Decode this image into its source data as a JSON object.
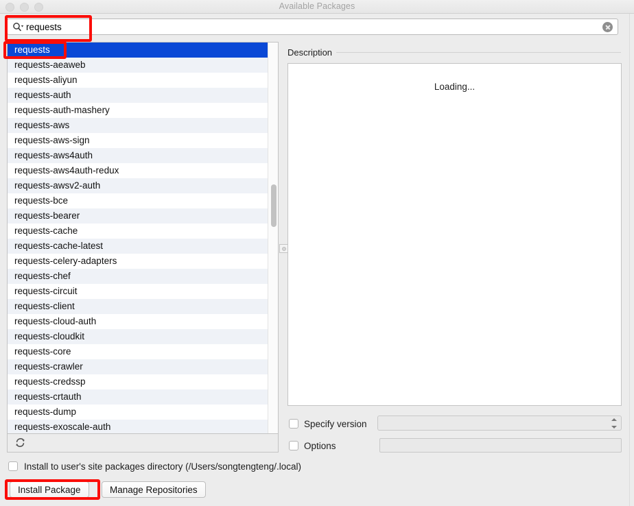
{
  "window": {
    "title": "Available Packages",
    "traffic_lights": [
      "close-button",
      "minimize-button",
      "zoom-button"
    ]
  },
  "search": {
    "icon": "search-icon",
    "value": "requests",
    "clear_icon": "clear-icon"
  },
  "package_list": {
    "selected": "requests",
    "items": [
      "requests",
      "requests-aeaweb",
      "requests-aliyun",
      "requests-auth",
      "requests-auth-mashery",
      "requests-aws",
      "requests-aws-sign",
      "requests-aws4auth",
      "requests-aws4auth-redux",
      "requests-awsv2-auth",
      "requests-bce",
      "requests-bearer",
      "requests-cache",
      "requests-cache-latest",
      "requests-celery-adapters",
      "requests-chef",
      "requests-circuit",
      "requests-client",
      "requests-cloud-auth",
      "requests-cloudkit",
      "requests-core",
      "requests-crawler",
      "requests-credssp",
      "requests-crtauth",
      "requests-dump",
      "requests-exoscale-auth"
    ],
    "refresh_icon": "refresh-icon"
  },
  "description": {
    "label": "Description",
    "body": "Loading..."
  },
  "options": {
    "specify_version_label": "Specify version",
    "specify_version_checked": false,
    "version_value": "",
    "options_label": "Options",
    "options_checked": false,
    "options_value": ""
  },
  "footer": {
    "user_site_label": "Install to user's site packages directory (/Users/songtengteng/.local)",
    "user_site_checked": false,
    "install_button": "Install Package",
    "manage_button": "Manage Repositories"
  },
  "annotations": {
    "color": "#fb0d08",
    "boxes": [
      "search-field",
      "selected-package-row",
      "install-package-button"
    ]
  }
}
